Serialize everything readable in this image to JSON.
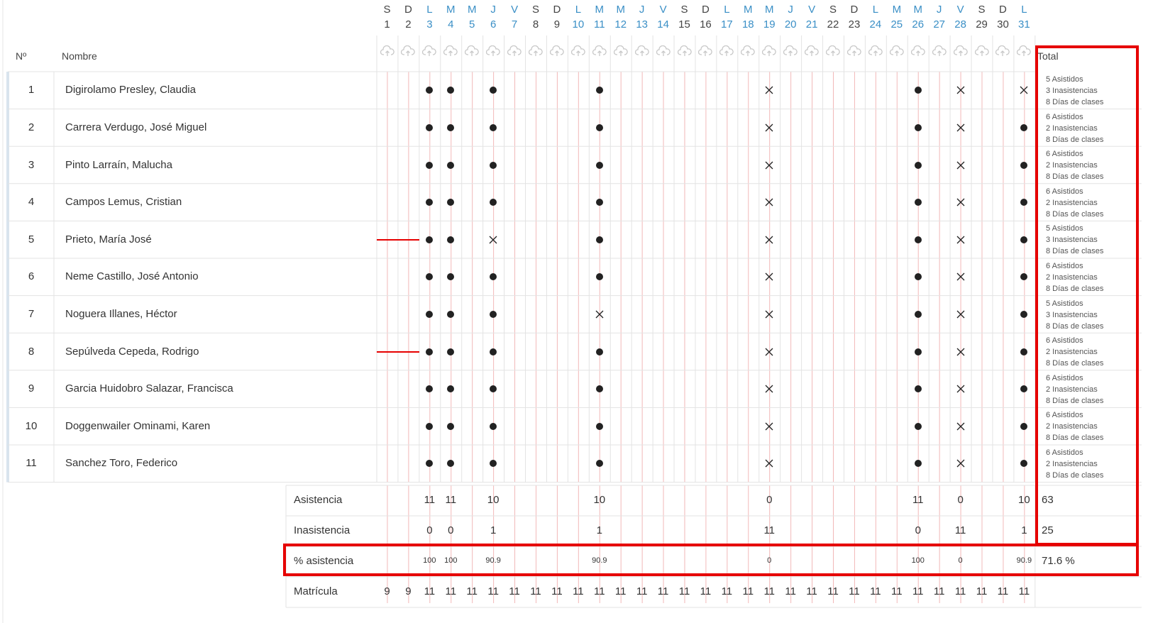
{
  "header": {
    "num_label": "Nº",
    "name_label": "Nombre",
    "total_label": "Total"
  },
  "days": [
    {
      "dow": "S",
      "num": "1",
      "type": "weekend"
    },
    {
      "dow": "D",
      "num": "2",
      "type": "weekend"
    },
    {
      "dow": "L",
      "num": "3",
      "type": "weekday"
    },
    {
      "dow": "M",
      "num": "4",
      "type": "weekday"
    },
    {
      "dow": "M",
      "num": "5",
      "type": "weekday"
    },
    {
      "dow": "J",
      "num": "6",
      "type": "weekday"
    },
    {
      "dow": "V",
      "num": "7",
      "type": "weekday"
    },
    {
      "dow": "S",
      "num": "8",
      "type": "weekend"
    },
    {
      "dow": "D",
      "num": "9",
      "type": "weekend"
    },
    {
      "dow": "L",
      "num": "10",
      "type": "weekday"
    },
    {
      "dow": "M",
      "num": "11",
      "type": "weekday"
    },
    {
      "dow": "M",
      "num": "12",
      "type": "weekday"
    },
    {
      "dow": "J",
      "num": "13",
      "type": "weekday"
    },
    {
      "dow": "V",
      "num": "14",
      "type": "weekday"
    },
    {
      "dow": "S",
      "num": "15",
      "type": "weekend"
    },
    {
      "dow": "D",
      "num": "16",
      "type": "weekend"
    },
    {
      "dow": "L",
      "num": "17",
      "type": "weekday"
    },
    {
      "dow": "M",
      "num": "18",
      "type": "weekday"
    },
    {
      "dow": "M",
      "num": "19",
      "type": "weekday"
    },
    {
      "dow": "J",
      "num": "20",
      "type": "weekday"
    },
    {
      "dow": "V",
      "num": "21",
      "type": "weekday"
    },
    {
      "dow": "S",
      "num": "22",
      "type": "weekend"
    },
    {
      "dow": "D",
      "num": "23",
      "type": "weekend"
    },
    {
      "dow": "L",
      "num": "24",
      "type": "weekday"
    },
    {
      "dow": "M",
      "num": "25",
      "type": "weekday"
    },
    {
      "dow": "M",
      "num": "26",
      "type": "weekday"
    },
    {
      "dow": "J",
      "num": "27",
      "type": "weekday"
    },
    {
      "dow": "V",
      "num": "28",
      "type": "weekday"
    },
    {
      "dow": "S",
      "num": "29",
      "type": "weekend"
    },
    {
      "dow": "D",
      "num": "30",
      "type": "weekend"
    },
    {
      "dow": "L",
      "num": "31",
      "type": "weekday"
    }
  ],
  "icons": {
    "upload": "cloud-upload-icon"
  },
  "colors": {
    "weekday": "#3a8fc6",
    "grid": "#f2b8b8",
    "highlight": "#e60000"
  },
  "students": [
    {
      "num": "1",
      "name": "Digirolamo Presley, Claudia",
      "marks": {
        "3": "dot",
        "4": "dot",
        "6": "dot",
        "11": "dot",
        "19": "x",
        "26": "dot",
        "28": "x",
        "31": "x"
      },
      "dash": false,
      "totals": [
        "5 Asistidos",
        "3 Inasistencias",
        "8 Días de clases"
      ]
    },
    {
      "num": "2",
      "name": "Carrera Verdugo, José Miguel",
      "marks": {
        "3": "dot",
        "4": "dot",
        "6": "dot",
        "11": "dot",
        "19": "x",
        "26": "dot",
        "28": "x",
        "31": "dot"
      },
      "dash": false,
      "totals": [
        "6 Asistidos",
        "2 Inasistencias",
        "8 Días de clases"
      ]
    },
    {
      "num": "3",
      "name": "Pinto Larraín, Malucha",
      "marks": {
        "3": "dot",
        "4": "dot",
        "6": "dot",
        "11": "dot",
        "19": "x",
        "26": "dot",
        "28": "x",
        "31": "dot"
      },
      "dash": false,
      "totals": [
        "6 Asistidos",
        "2 Inasistencias",
        "8 Días de clases"
      ]
    },
    {
      "num": "4",
      "name": "Campos Lemus, Cristian",
      "marks": {
        "3": "dot",
        "4": "dot",
        "6": "dot",
        "11": "dot",
        "19": "x",
        "26": "dot",
        "28": "x",
        "31": "dot"
      },
      "dash": false,
      "totals": [
        "6 Asistidos",
        "2 Inasistencias",
        "8 Días de clases"
      ]
    },
    {
      "num": "5",
      "name": "Prieto, María José",
      "marks": {
        "3": "dot",
        "4": "dot",
        "6": "x",
        "11": "dot",
        "19": "x",
        "26": "dot",
        "28": "x",
        "31": "dot"
      },
      "dash": true,
      "totals": [
        "5 Asistidos",
        "3 Inasistencias",
        "8 Días de clases"
      ]
    },
    {
      "num": "6",
      "name": "Neme Castillo, José Antonio",
      "marks": {
        "3": "dot",
        "4": "dot",
        "6": "dot",
        "11": "dot",
        "19": "x",
        "26": "dot",
        "28": "x",
        "31": "dot"
      },
      "dash": false,
      "totals": [
        "6 Asistidos",
        "2 Inasistencias",
        "8 Días de clases"
      ]
    },
    {
      "num": "7",
      "name": "Noguera Illanes, Héctor",
      "marks": {
        "3": "dot",
        "4": "dot",
        "6": "dot",
        "11": "x",
        "19": "x",
        "26": "dot",
        "28": "x",
        "31": "dot"
      },
      "dash": false,
      "totals": [
        "5 Asistidos",
        "3 Inasistencias",
        "8 Días de clases"
      ]
    },
    {
      "num": "8",
      "name": "Sepúlveda Cepeda, Rodrigo",
      "marks": {
        "3": "dot",
        "4": "dot",
        "6": "dot",
        "11": "dot",
        "19": "x",
        "26": "dot",
        "28": "x",
        "31": "dot"
      },
      "dash": true,
      "totals": [
        "6 Asistidos",
        "2 Inasistencias",
        "8 Días de clases"
      ]
    },
    {
      "num": "9",
      "name": "Garcia Huidobro Salazar, Francisca",
      "marks": {
        "3": "dot",
        "4": "dot",
        "6": "dot",
        "11": "dot",
        "19": "x",
        "26": "dot",
        "28": "x",
        "31": "dot"
      },
      "dash": false,
      "totals": [
        "6 Asistidos",
        "2 Inasistencias",
        "8 Días de clases"
      ]
    },
    {
      "num": "10",
      "name": "Doggenwailer Ominami, Karen",
      "marks": {
        "3": "dot",
        "4": "dot",
        "6": "dot",
        "11": "dot",
        "19": "x",
        "26": "dot",
        "28": "x",
        "31": "dot"
      },
      "dash": false,
      "totals": [
        "6 Asistidos",
        "2 Inasistencias",
        "8 Días de clases"
      ]
    },
    {
      "num": "11",
      "name": "Sanchez Toro, Federico",
      "marks": {
        "3": "dot",
        "4": "dot",
        "6": "dot",
        "11": "dot",
        "19": "x",
        "26": "dot",
        "28": "x",
        "31": "dot"
      },
      "dash": false,
      "totals": [
        "6 Asistidos",
        "2 Inasistencias",
        "8 Días de clases"
      ]
    }
  ],
  "summary": {
    "asistencia": {
      "label": "Asistencia",
      "values": {
        "3": "11",
        "4": "11",
        "6": "10",
        "11": "10",
        "19": "0",
        "26": "11",
        "28": "0",
        "31": "10"
      },
      "total": "63"
    },
    "inasistencia": {
      "label": "Inasistencia",
      "values": {
        "3": "0",
        "4": "0",
        "6": "1",
        "11": "1",
        "19": "11",
        "26": "0",
        "28": "11",
        "31": "1"
      },
      "total": "25"
    },
    "porcentaje": {
      "label": "% asistencia",
      "values": {
        "3": "100",
        "4": "100",
        "6": "90.9",
        "11": "90.9",
        "19": "0",
        "26": "100",
        "28": "0",
        "31": "90.9"
      },
      "total": "71.6 %"
    },
    "matricula": {
      "label": "Matrícula",
      "values": {
        "1": "9",
        "2": "9",
        "3": "11",
        "4": "11",
        "5": "11",
        "6": "11",
        "7": "11",
        "8": "11",
        "9": "11",
        "10": "11",
        "11": "11",
        "12": "11",
        "13": "11",
        "14": "11",
        "15": "11",
        "16": "11",
        "17": "11",
        "18": "11",
        "19": "11",
        "20": "11",
        "21": "11",
        "22": "11",
        "23": "11",
        "24": "11",
        "25": "11",
        "26": "11",
        "27": "11",
        "28": "11",
        "29": "11",
        "30": "11",
        "31": "11"
      }
    }
  }
}
